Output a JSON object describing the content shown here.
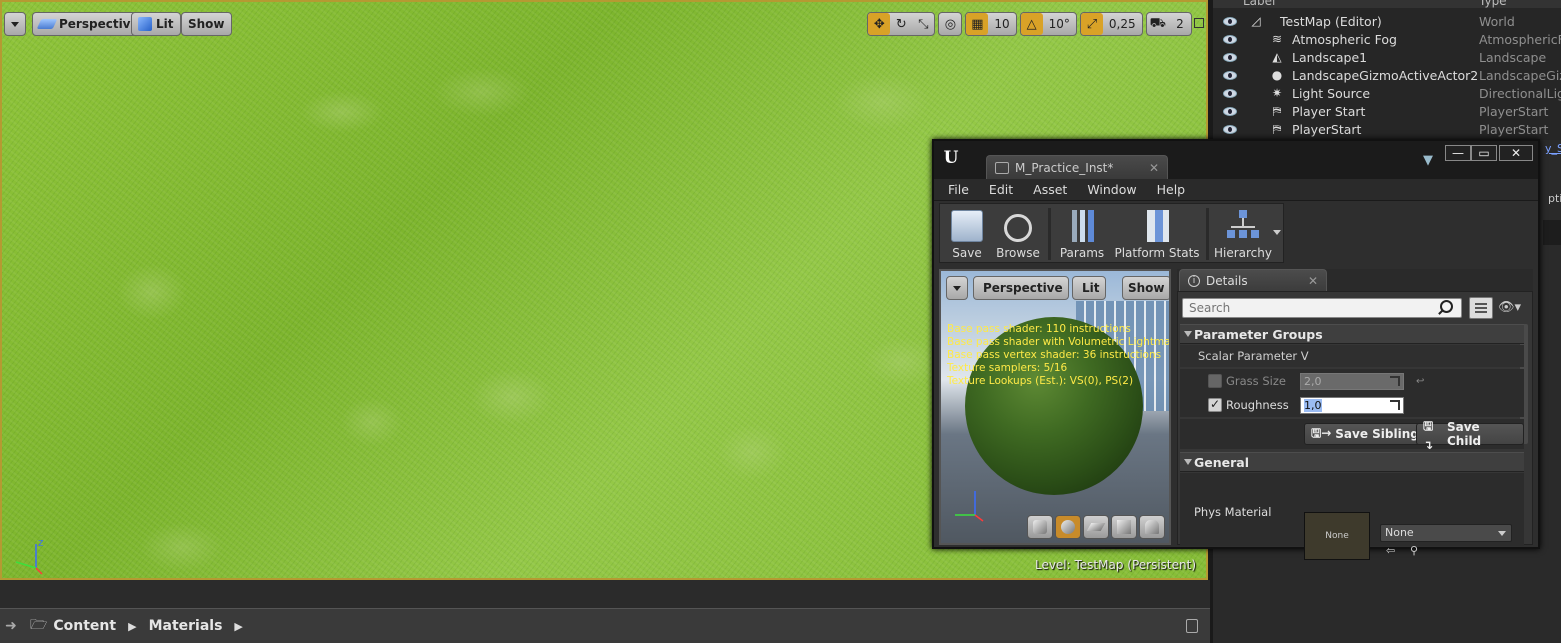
{
  "viewport": {
    "dropdown_label": "",
    "perspective_label": "Perspective",
    "lit_label": "Lit",
    "show_label": "Show",
    "grid_snap_value": "10",
    "rotation_snap_value": "10°",
    "scale_snap_value": "0,25",
    "camera_speed_value": "2",
    "level_label": "Level:  TestMap (Persistent)",
    "accent_color": "#d9a227"
  },
  "content_browser": {
    "breadcrumbs": [
      "Content",
      "Materials"
    ]
  },
  "outliner": {
    "col_label": "Label",
    "col_type": "Type",
    "rows": [
      {
        "label": "TestMap (Editor)",
        "type": "World",
        "icon": "world-icon"
      },
      {
        "label": "Atmospheric Fog",
        "type": "AtmosphericFog",
        "icon": "fog-icon"
      },
      {
        "label": "Landscape1",
        "type": "Landscape",
        "icon": "landscape-icon"
      },
      {
        "label": "LandscapeGizmoActiveActor2",
        "type": "LandscapeGizm",
        "icon": "sphere-icon"
      },
      {
        "label": "Light Source",
        "type": "DirectionalLight",
        "icon": "light-icon"
      },
      {
        "label": "Player Start",
        "type": "PlayerStart",
        "icon": "player-start-icon"
      },
      {
        "label": "PlayerStart",
        "type": "PlayerStart",
        "icon": "player-start-icon"
      }
    ],
    "link_fragment": "y_S",
    "options_fragment": "ptio"
  },
  "material_editor": {
    "tab_title": "M_Practice_Inst*",
    "menu": [
      "File",
      "Edit",
      "Asset",
      "Window",
      "Help"
    ],
    "toolbar": {
      "save": "Save",
      "browse": "Browse",
      "params": "Params",
      "platform_stats": "Platform Stats",
      "hierarchy": "Hierarchy"
    },
    "preview": {
      "perspective_label": "Perspective",
      "lit_label": "Lit",
      "show_label": "Show",
      "stats": [
        "Base pass shader: 110 instructions",
        "Base pass shader with Volumetric Lightmap",
        "Base pass vertex shader: 36 instructions",
        "Texture samplers: 5/16",
        "Texture Lookups (Est.): VS(0), PS(2)"
      ],
      "stats_color": "#ffea47"
    },
    "details": {
      "tab_label": "Details",
      "search_placeholder": "Search",
      "parameter_groups_label": "Parameter Groups",
      "scalar_group_label": "Scalar Parameter V",
      "grass_size_label": "Grass Size",
      "grass_size_value": "2,0",
      "roughness_label": "Roughness",
      "roughness_value": "1,0",
      "save_sibling_label": "Save Sibling",
      "save_child_label": "Save Child",
      "general_label": "General",
      "phys_material_label": "Phys Material",
      "phys_thumb_label": "None",
      "phys_combo_value": "None"
    }
  }
}
